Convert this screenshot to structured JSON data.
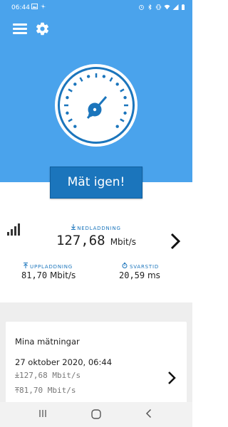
{
  "status_bar": {
    "time": "06:44",
    "left_icons": [
      "image-notification-icon",
      "fan-notification-icon"
    ],
    "right_icons": [
      "alarm-icon",
      "bluetooth-icon",
      "vibrate-icon",
      "wifi-icon",
      "signal-icon",
      "battery-icon"
    ]
  },
  "header": {
    "menu_icon": "hamburger-menu-icon",
    "settings_icon": "gear-icon"
  },
  "colors": {
    "hero_background": "#4aa3ec",
    "primary_blue": "#1b75bc",
    "history_background": "#eeeeee"
  },
  "gauge": {
    "icon": "speedometer-gauge-icon"
  },
  "cta": {
    "label": "Mät igen!"
  },
  "results": {
    "signal_icon": "signal-strength-icon",
    "download": {
      "label": "NEDLADDNING",
      "value": "127,68",
      "unit": "Mbit/s"
    },
    "upload": {
      "label": "UPPLADDNING",
      "value": "81,70",
      "unit": "Mbit/s"
    },
    "latency": {
      "label": "SVARSTID",
      "value": "20,59",
      "unit": "ms"
    }
  },
  "history": {
    "title": "Mina mätningar",
    "date": "27 oktober 2020, 06:44",
    "download": "127,68 Mbit/s",
    "upload": "81,70 Mbit/s"
  },
  "nav_bar": {
    "icons": [
      "recents-icon",
      "home-icon",
      "back-icon"
    ]
  }
}
